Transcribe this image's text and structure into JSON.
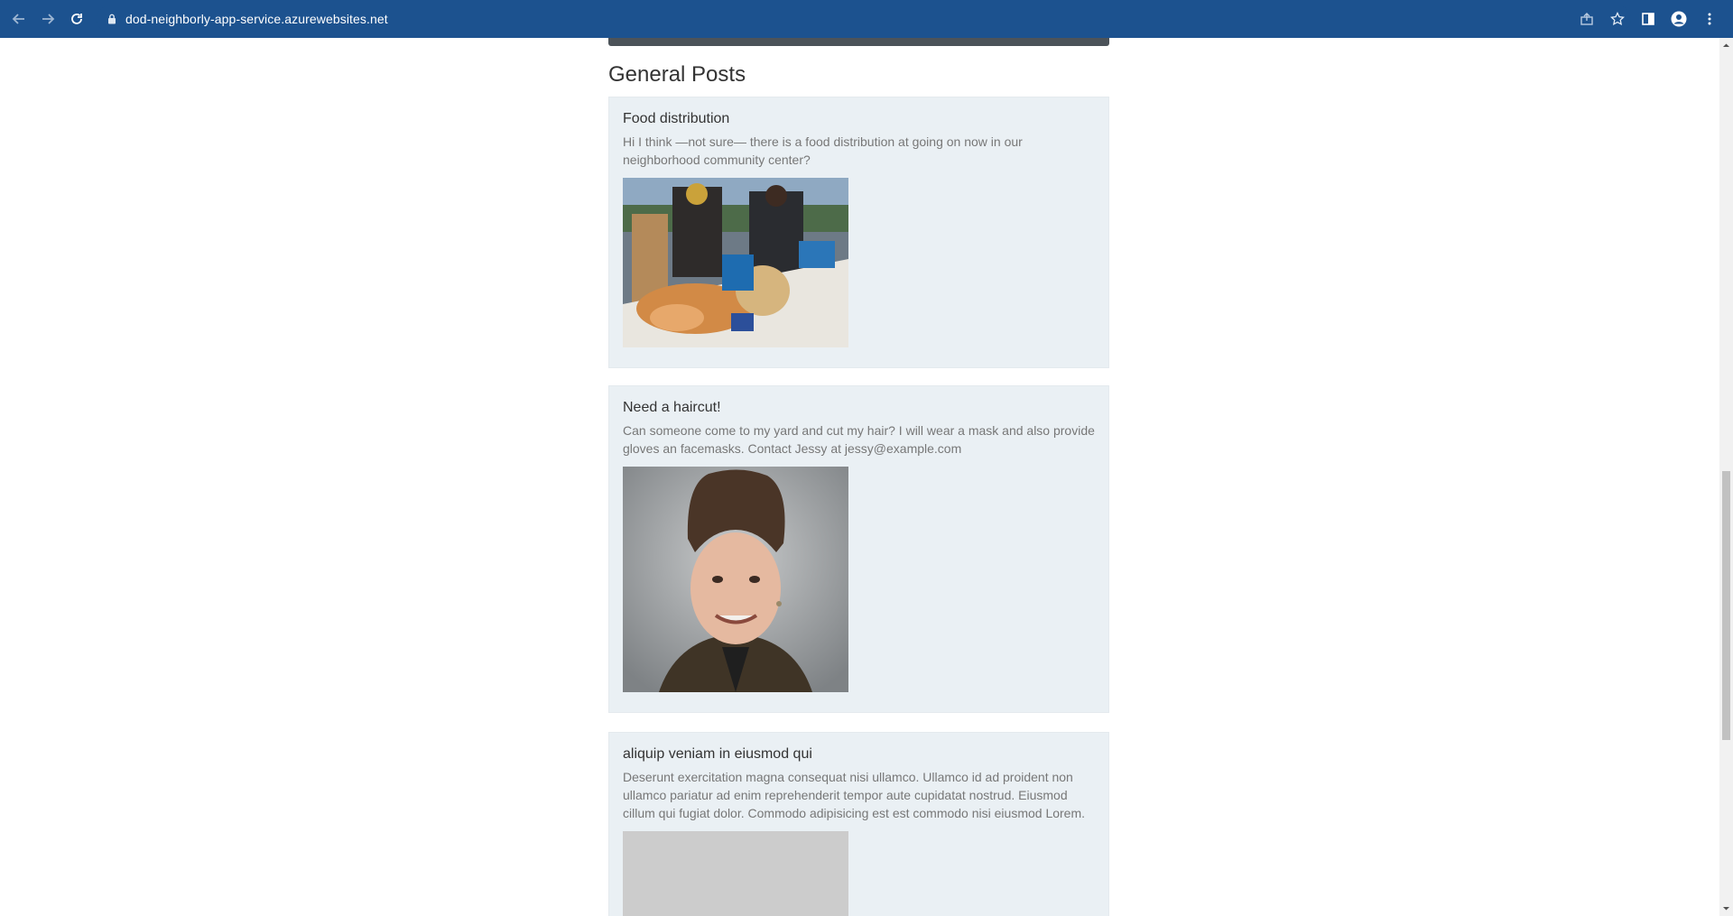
{
  "browser": {
    "url": "dod-neighborly-app-service.azurewebsites.net"
  },
  "page": {
    "section_title": "General Posts",
    "posts": [
      {
        "title": "Food distribution",
        "body": "Hi I think —not sure— there is a food distribution at going on now in our neighborhood community center?"
      },
      {
        "title": "Need a haircut!",
        "body": "Can someone come to my yard and cut my hair? I will wear a mask and also provide gloves an facemasks. Contact Jessy at jessy@example.com"
      },
      {
        "title": "aliquip veniam in eiusmod qui",
        "body": "Deserunt exercitation magna consequat nisi ullamco. Ullamco id ad proident non ullamco pariatur ad enim reprehenderit tempor aute cupidatat nostrud. Eiusmod cillum qui fugiat dolor. Commodo adipisicing est est commodo nisi eiusmod Lorem."
      }
    ]
  },
  "colors": {
    "browser_bar": "#1c528f",
    "post_background": "#eaf0f4"
  }
}
